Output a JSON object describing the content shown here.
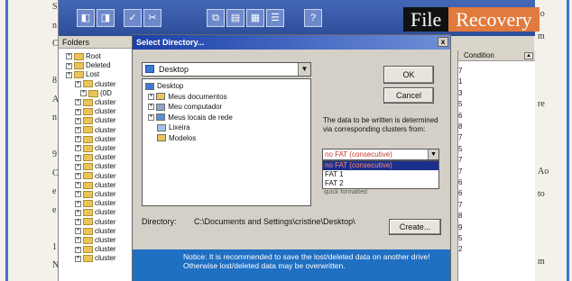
{
  "brand": {
    "word1": "File",
    "word2": "Recovery"
  },
  "toolbar": {
    "icons": [
      "back-icon",
      "forward-icon",
      "check-icon",
      "cut-icon",
      "copy-icon",
      "paste-icon",
      "grid-icon",
      "list-icon",
      "help-icon"
    ]
  },
  "folders": {
    "header": "Folders",
    "items": [
      {
        "label": "Root"
      },
      {
        "label": "Deleted"
      },
      {
        "label": "Lost"
      },
      {
        "label": "cluster"
      },
      {
        "label": "(0D"
      },
      {
        "label": "cluster"
      },
      {
        "label": "cluster"
      },
      {
        "label": "cluster"
      },
      {
        "label": "cluster"
      },
      {
        "label": "cluster"
      },
      {
        "label": "cluster"
      },
      {
        "label": "cluster"
      },
      {
        "label": "cluster"
      },
      {
        "label": "cluster"
      },
      {
        "label": "cluster"
      },
      {
        "label": "cluster"
      },
      {
        "label": "cluster"
      },
      {
        "label": "cluster"
      },
      {
        "label": "cluster"
      },
      {
        "label": "cluster"
      },
      {
        "label": "cluster"
      },
      {
        "label": "cluster"
      },
      {
        "label": "cluster"
      }
    ]
  },
  "right_pane": {
    "column": "Condition",
    "numbers": [
      "7",
      "1",
      "3",
      "5",
      "6",
      "8",
      "7",
      "5",
      "7",
      "7",
      "6",
      "6",
      "7",
      "8",
      "9",
      "5",
      "2"
    ]
  },
  "dialog": {
    "title": "Select Directory...",
    "drive": "Desktop",
    "tree": [
      {
        "label": "Desktop"
      },
      {
        "label": "Meus documentos"
      },
      {
        "label": "Meu computador"
      },
      {
        "label": "Meus locais de rede"
      },
      {
        "label": "Lixeira"
      },
      {
        "label": "Modelos"
      }
    ],
    "ok": "OK",
    "cancel": "Cancel",
    "info": "The data to be written is determined via corresponding clusters from:",
    "fat_selected": "no FAT (consecutive)",
    "fat_options": [
      "no FAT (consecutive)",
      "FAT 1",
      "FAT 2"
    ],
    "quick": "quick formatted",
    "directory_label": "Directory:",
    "directory_value": "C:\\Documents and Settings\\cristine\\Desktop\\",
    "create": "Create...",
    "notice": "Notice: It is recommended to save the lost/deleted data on another drive! Otherwise lost/deleted data may be overwritten."
  },
  "page_margin": {
    "left_letters": [
      "S",
      "n",
      "C",
      "",
      "8",
      "A",
      "n",
      "",
      "9",
      "C",
      "e",
      "e",
      "",
      "1",
      "N"
    ],
    "right_words": [
      "io",
      "m",
      "",
      "",
      "re",
      "",
      "",
      "Ao",
      "to",
      "",
      "",
      "m"
    ]
  }
}
